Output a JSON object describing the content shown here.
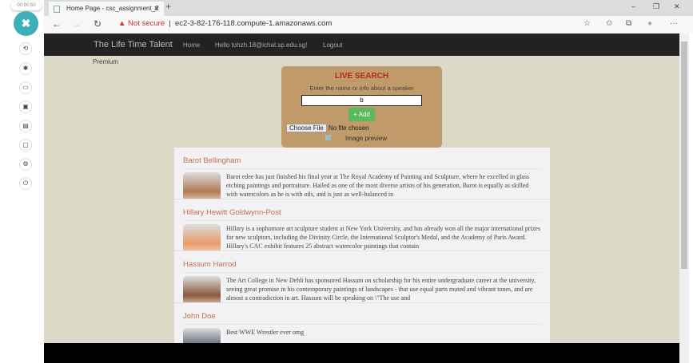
{
  "recorder": {
    "timer": "00:00:50",
    "close": "✖",
    "tools": [
      "⟲",
      "✱",
      "▭",
      "▣",
      "▤",
      "▢",
      "⚙",
      "⏻"
    ]
  },
  "browser": {
    "tab_title": "Home Page - csc_assignment_2",
    "tab_close": "✕",
    "new_tab": "+",
    "not_secure": "Not secure",
    "url": "ec2-3-82-176-118.compute-1.amazonaws.com",
    "back": "←",
    "forward": "→",
    "refresh": "↻",
    "minimize": "–",
    "restore": "❐",
    "close": "✕",
    "star": "☆",
    "favorites": "✩",
    "collections": "⧉",
    "profile": "●",
    "more": "···"
  },
  "navbar": {
    "brand": "The Life Time Talent",
    "home": "Home",
    "greeting": "Hello tohzh.18@ichat.sp.edu.sg!",
    "logout": "Logout",
    "premium": "Premium"
  },
  "search": {
    "title": "LIVE SEARCH",
    "label": "Enter the name or info about a speaker",
    "value": "b",
    "add": "+ Add",
    "choose_file": "Choose File",
    "no_file": "No file chosen",
    "preview": "Image preview"
  },
  "speakers": [
    {
      "name": "Barot Bellingham",
      "desc": "Barot edee has just finished his final year at The Royal Academy of Painting and Sculpture, where he excelled in glass etching paintings and portraiture. Hailed as one of the most diverse artists of his generation, Barot is equally as skilled with watercolors as he is with oils, and is just as well-balanced in",
      "color": "#b07a55"
    },
    {
      "name": "Hillary Hewitt Goldwynn-Post",
      "desc": "Hillary is a sophomore art sculpture student at New York University, and has already won all the major international prizes for new sculptors, including the Divinity Circle, the International Sculptor's Medal, and the Academy of Paris Award. Hillary's CAC exhibit features 25 abstract watercolor paintings that contain",
      "color": "#e89a6a"
    },
    {
      "name": "Hassum Harrod",
      "desc": "The Art College in New Dehli has sponsored Hassum on scholarship for his entire undergraduate career at the university, seeing great promise in his contemporary paintings of landscapes - that use equal parts muted and vibrant tones, and are almost a contradiction in art. Hassum will be speaking on \\\"The use and",
      "color": "#8a5a40"
    },
    {
      "name": "John Doe",
      "desc": "Best WWE Wrestler ever omg",
      "color": "#556070"
    }
  ]
}
